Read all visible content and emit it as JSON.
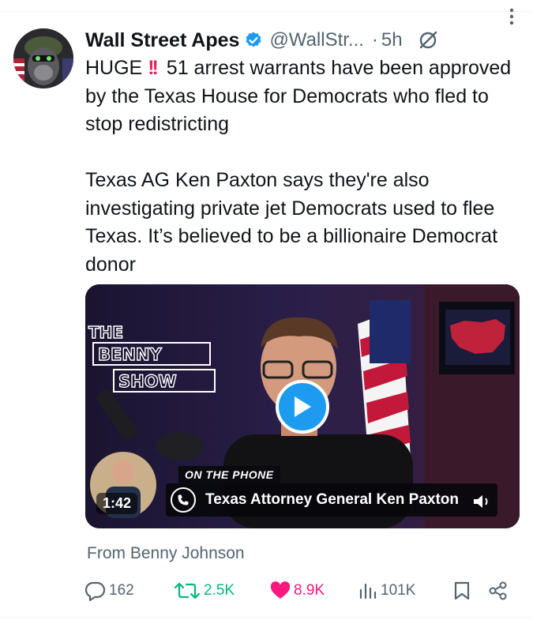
{
  "author": {
    "display_name": "Wall Street Apes",
    "handle": "@WallStr...",
    "time_separator": "·",
    "time": "5h"
  },
  "tweet": {
    "emphasis": "HUGE",
    "paragraph1": " 51 arrest warrants have been approved by the Texas House for Democrats who fled to stop redistricting",
    "paragraph2": "Texas AG Ken Paxton says they're also investigating private jet Democrats used to flee Texas. It’s believed to be a billionaire Democrat donor"
  },
  "media": {
    "logo_line1": "THE",
    "logo_line2": "BENNY",
    "logo_line3": "SHOW",
    "duration": "1:42",
    "lower_third_tag": "ON THE PHONE",
    "lower_third_text": "Texas Attorney General Ken Paxton"
  },
  "source": "From Benny Johnson",
  "actions": {
    "replies": "162",
    "reposts": "2.5K",
    "likes": "8.9K",
    "views": "101K"
  },
  "colors": {
    "accent": "#1d9bf0",
    "repost": "#00ba7c",
    "like": "#f91880",
    "muted": "#536471"
  }
}
